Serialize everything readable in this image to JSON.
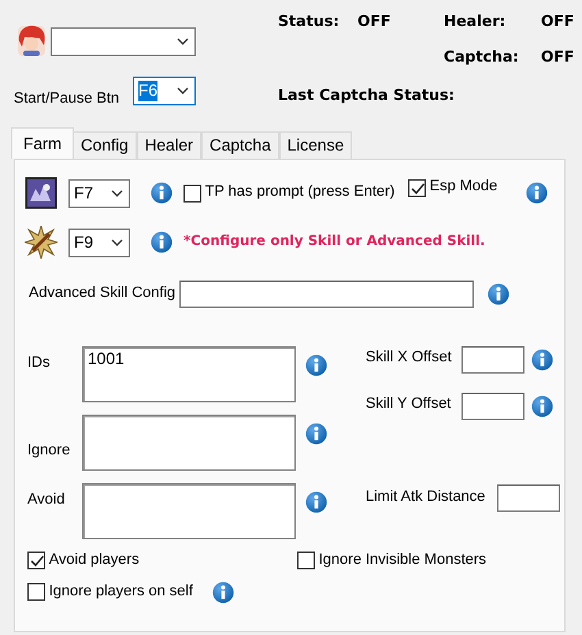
{
  "header": {
    "profile_select": {
      "kind": "combo"
    },
    "status": [
      {
        "label": "Status:",
        "value": "OFF"
      },
      {
        "label": "Healer:",
        "value": "OFF"
      },
      {
        "label": "Captcha:",
        "value": "OFF"
      }
    ],
    "start_pause": {
      "label": "Start/Pause Btn",
      "value": "F6"
    },
    "last_captcha": {
      "label": "Last Captcha Status:"
    }
  },
  "tabs": [
    {
      "label": "Farm",
      "selected": true
    },
    {
      "label": "Config",
      "selected": false
    },
    {
      "label": "Healer",
      "selected": false
    },
    {
      "label": "Captcha",
      "selected": false
    },
    {
      "label": "License",
      "selected": false
    }
  ],
  "farm": {
    "skill_rows": [
      {
        "key": "F7"
      },
      {
        "key": "F9"
      }
    ],
    "tp_prompt": {
      "label": "TP has prompt (press Enter)",
      "checked": false
    },
    "esp_mode": {
      "label": "Esp Mode",
      "checked": true
    },
    "warning": "*Configure only Skill or Advanced Skill.",
    "advanced_skill_config": {
      "label": "Advanced Skill Config"
    },
    "lists": [
      {
        "label": "IDs",
        "value": "1001"
      },
      {
        "label": "Ignore"
      },
      {
        "label": "Avoid"
      }
    ],
    "offsets": [
      {
        "label": "Skill X Offset"
      },
      {
        "label": "Skill Y Offset"
      }
    ],
    "limit_atk_distance": {
      "label": "Limit Atk Distance"
    },
    "options": [
      {
        "label": "Avoid players",
        "checked": true
      },
      {
        "label": "Ignore Invisible Monsters",
        "checked": false
      },
      {
        "label": "Ignore players on self",
        "checked": false
      }
    ]
  }
}
